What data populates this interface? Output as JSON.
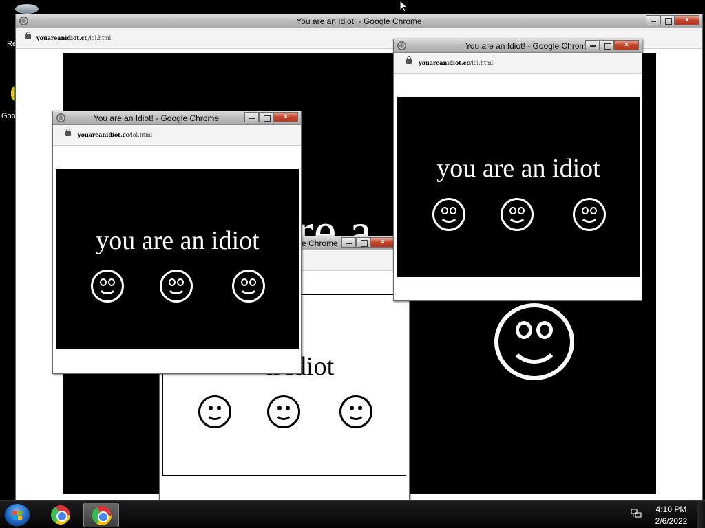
{
  "desktop": {
    "icons": [
      {
        "label": "Re"
      },
      {
        "label": "Goo"
      }
    ]
  },
  "window_main": {
    "title": "You are an Idiot! - Google Chrome",
    "url_host": "youareanidiot.cc",
    "url_path": "/lol.html",
    "text": "re a"
  },
  "window_right": {
    "title": "You are an Idiot! - Google Chrome",
    "url_host": "youareanidiot.cc",
    "url_path": "/lol.html",
    "text": "you are an idiot"
  },
  "window_left": {
    "title": "You are an Idiot! - Google Chrome",
    "url_host": "youareanidiot.cc",
    "url_path": "/lol.html",
    "text": "you are an idiot"
  },
  "window_mid": {
    "title": "ogle Chrome",
    "text": "n idiot"
  },
  "taskbar": {
    "time": "4:10 PM",
    "date": "2/6/2022"
  },
  "colors": {
    "black": "#000000",
    "white": "#ffffff",
    "close_red": "#c4452b"
  }
}
